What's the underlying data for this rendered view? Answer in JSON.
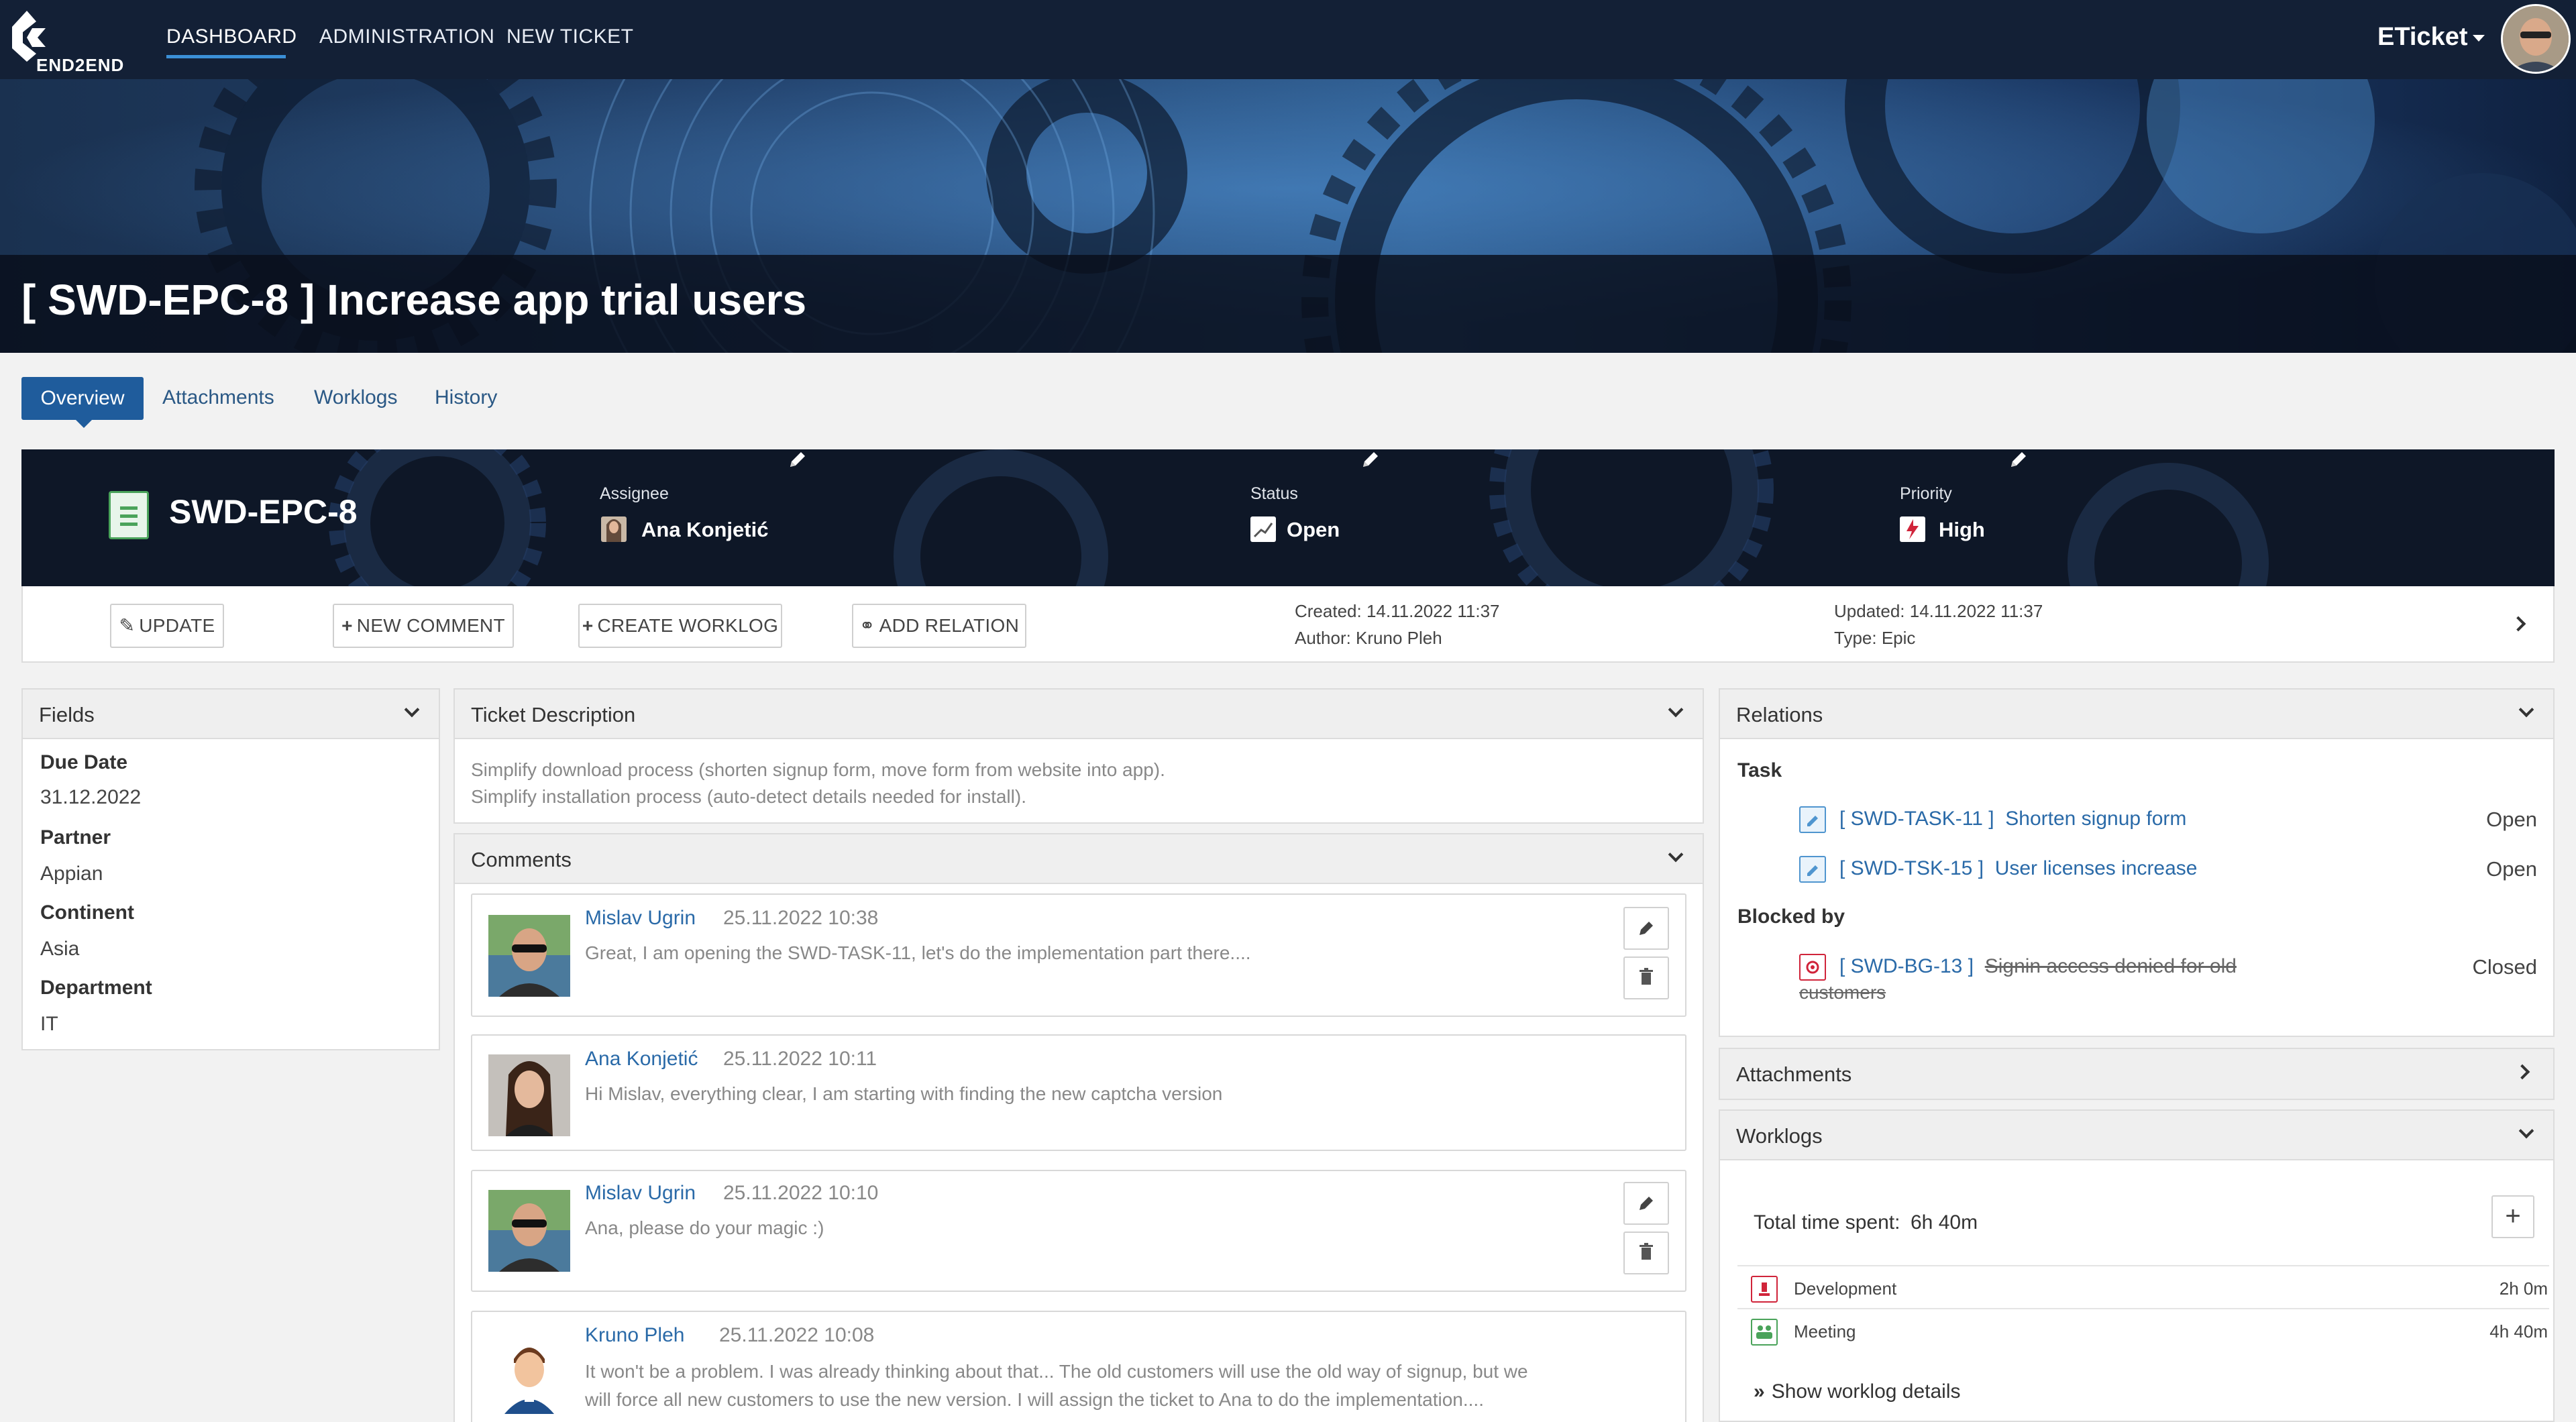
{
  "nav": {
    "brand": "END2END",
    "items": [
      "DASHBOARD",
      "ADMINISTRATION",
      "NEW TICKET"
    ],
    "user": "ETicket"
  },
  "hero": {
    "title": "[ SWD-EPC-8 ] Increase app trial users"
  },
  "tabs": [
    "Overview",
    "Attachments",
    "Worklogs",
    "History"
  ],
  "ticket": {
    "key": "SWD-EPC-8",
    "assignee_label": "Assignee",
    "assignee": "Ana Konjetić",
    "status_label": "Status",
    "status": "Open",
    "priority_label": "Priority",
    "priority": "High"
  },
  "actions": {
    "update": "UPDATE",
    "new_comment": "NEW COMMENT",
    "create_worklog": "CREATE WORKLOG",
    "add_relation": "ADD RELATION",
    "created": "Created: 14.11.2022 11:37",
    "author": "Author: Kruno Pleh",
    "updated": "Updated: 14.11.2022 11:37",
    "type": "Type: Epic"
  },
  "fields": {
    "title": "Fields",
    "items": [
      {
        "label": "Due Date",
        "value": "31.12.2022"
      },
      {
        "label": "Partner",
        "value": "Appian"
      },
      {
        "label": "Continent",
        "value": "Asia"
      },
      {
        "label": "Department",
        "value": "IT"
      }
    ]
  },
  "description": {
    "title": "Ticket Description",
    "lines": [
      "Simplify download process (shorten signup form, move form from website into app).",
      "Simplify installation process (auto-detect details needed for install)."
    ]
  },
  "comments": {
    "title": "Comments",
    "items": [
      {
        "author": "Mislav Ugrin",
        "date": "25.11.2022 10:38",
        "text": [
          "Great, I am opening the SWD-TASK-11, let's do the implementation part there...."
        ]
      },
      {
        "author": "Ana Konjetić",
        "date": "25.11.2022 10:11",
        "text": [
          "Hi Mislav, everything clear, I am starting with finding the new captcha version"
        ]
      },
      {
        "author": "Mislav Ugrin",
        "date": "25.11.2022 10:10",
        "text": [
          "Ana, please do your magic :)"
        ]
      },
      {
        "author": "Kruno Pleh",
        "date": "25.11.2022 10:08",
        "text": [
          "It won't be a problem. I was already thinking about that... The old customers will use the old way of signup, but we",
          "will force all new customers to use the new version. I will assign the ticket to Ana to do the implementation...."
        ]
      }
    ]
  },
  "relations": {
    "title": "Relations",
    "groups": [
      {
        "name": "Task",
        "items": [
          {
            "key": "[ SWD-TASK-11 ]",
            "title": "Shorten signup form",
            "status": "Open"
          },
          {
            "key": "[ SWD-TSK-15 ]",
            "title": "User licenses increase",
            "status": "Open"
          }
        ]
      },
      {
        "name": "Blocked by",
        "items": [
          {
            "key": "[ SWD-BG-13 ]",
            "title": "Signin access denied for old",
            "title_cont": "customers",
            "status": "Closed"
          }
        ]
      }
    ]
  },
  "attachments": {
    "title": "Attachments"
  },
  "worklogs": {
    "title": "Worklogs",
    "total_label": "Total time spent:",
    "total": "6h 40m",
    "items": [
      {
        "name": "Development",
        "time": "2h 0m"
      },
      {
        "name": "Meeting",
        "time": "4h 40m"
      }
    ],
    "show_details": "Show worklog details"
  },
  "colors": {
    "nav_bg": "#132036",
    "accent": "#1f5c9c",
    "link": "#2a6aa8"
  }
}
